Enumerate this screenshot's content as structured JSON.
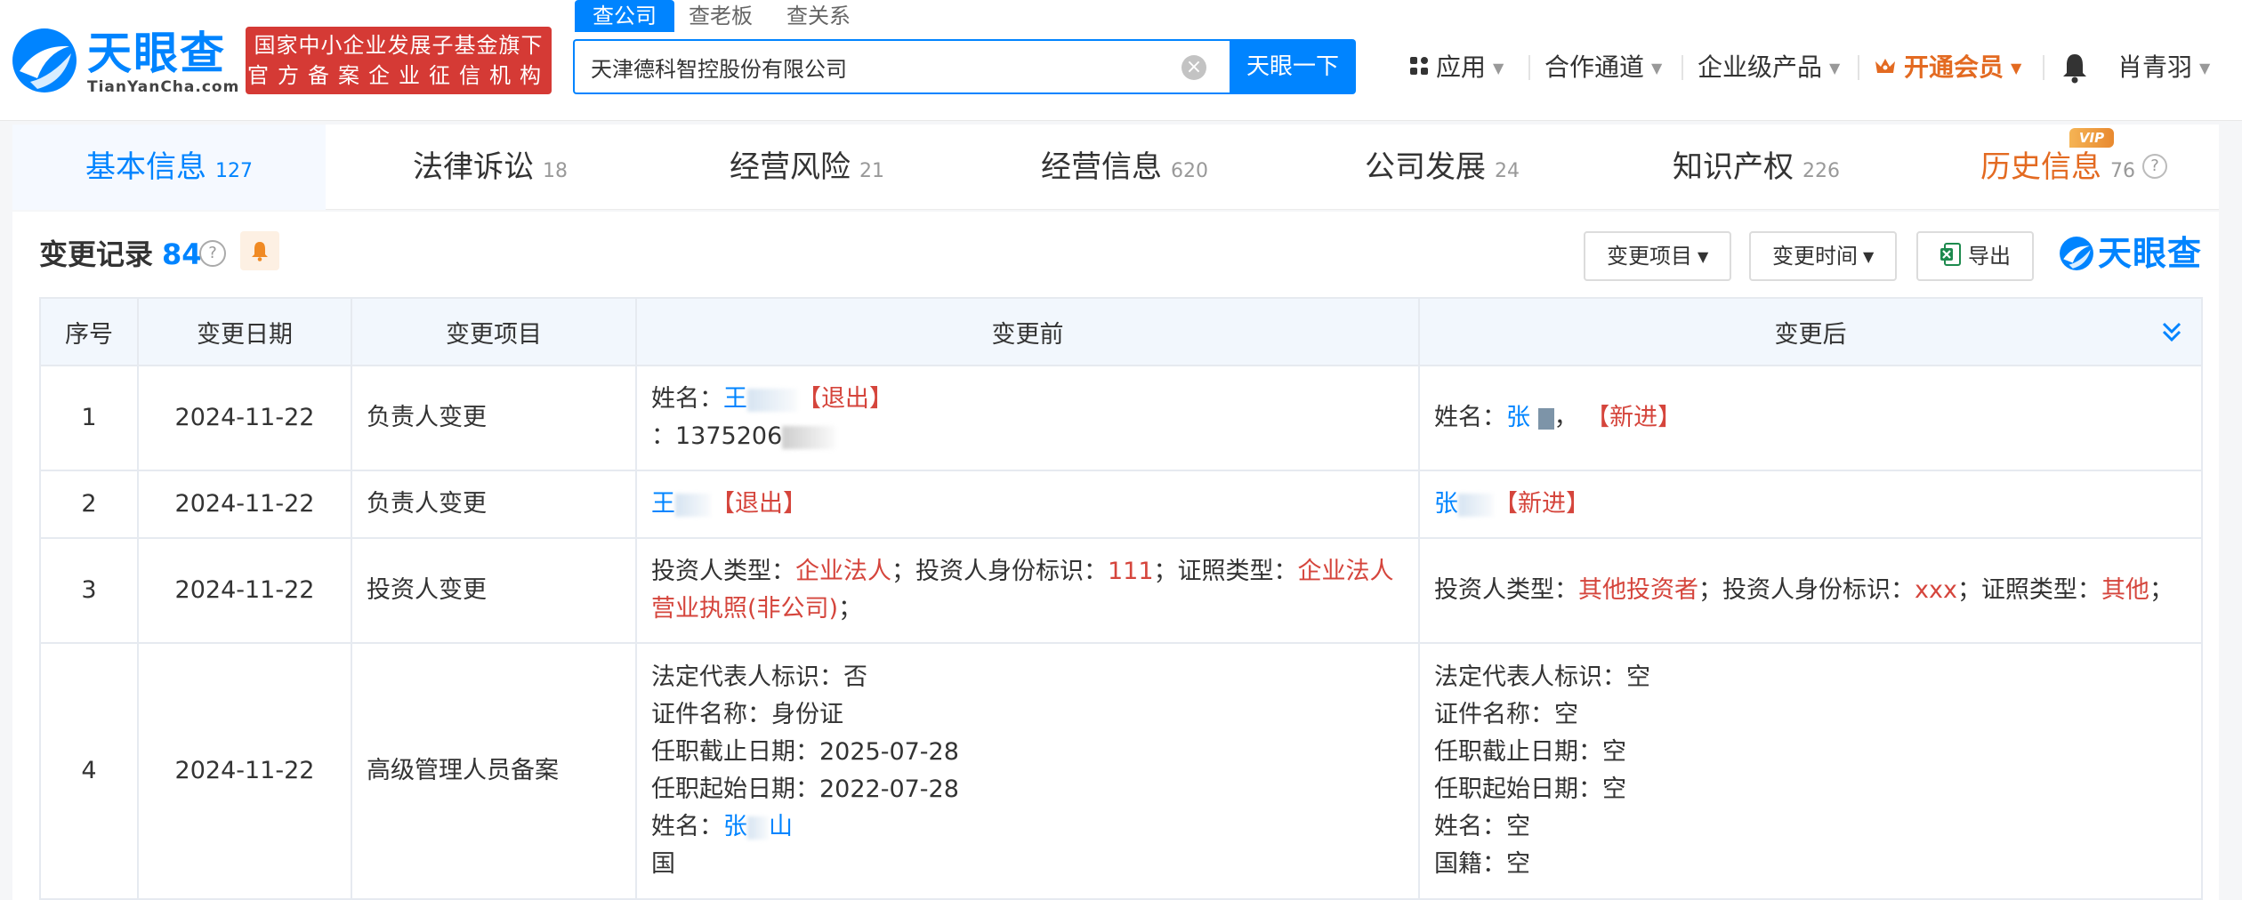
{
  "brand": {
    "name": "天眼查",
    "url": "TianYanCha.com",
    "badge_line1": "国家中小企业发展子基金旗下",
    "badge_line2": "官方备案企业征信机构",
    "accent": "#0084ff",
    "badge_color": "#d53a35"
  },
  "search": {
    "tabs": [
      {
        "label": "查公司",
        "active": true
      },
      {
        "label": "查老板",
        "active": false
      },
      {
        "label": "查关系",
        "active": false
      }
    ],
    "value": "天津德科智控股份有限公司",
    "button": "天眼一下"
  },
  "topnav": {
    "apps": "应用",
    "partner": "合作通道",
    "enterprise": "企业级产品",
    "vip": "开通会员",
    "user": "肖青羽",
    "vip_color": "#e36a21"
  },
  "modules": [
    {
      "label": "基本信息",
      "count": "127",
      "active": true
    },
    {
      "label": "法律诉讼",
      "count": "18"
    },
    {
      "label": "经营风险",
      "count": "21"
    },
    {
      "label": "经营信息",
      "count": "620"
    },
    {
      "label": "公司发展",
      "count": "24"
    },
    {
      "label": "知识产权",
      "count": "226"
    },
    {
      "label": "历史信息",
      "count": "76",
      "vip_tag": "VIP"
    }
  ],
  "section": {
    "title": "变更记录",
    "count": "84",
    "help": "?",
    "filter_item": "变更项目",
    "filter_time": "变更时间",
    "export": "导出",
    "watermark": "天眼查"
  },
  "table": {
    "headers": {
      "idx": "序号",
      "date": "变更日期",
      "item": "变更项目",
      "before": "变更前",
      "after": "变更后"
    },
    "rows": [
      {
        "idx": "1",
        "date": "2024-11-22",
        "item": "负责人变更",
        "b_name_label": "姓名：",
        "b_name": "王",
        "b_tag": "【退出】",
        "b_phone_prefix": "：",
        "b_phone": "1375206",
        "a_name_label": "姓名：",
        "a_name": "张",
        "a_sep": "，",
        "a_tag": "【新进】"
      },
      {
        "idx": "2",
        "date": "2024-11-22",
        "item": "负责人变更",
        "b_name": "王",
        "b_tag": "【退出】",
        "a_name": "张",
        "a_tag": "【新进】"
      },
      {
        "idx": "3",
        "date": "2024-11-22",
        "item": "投资人变更",
        "b_l1": "投资人类型：",
        "b_v1": "企业法人",
        "b_l2": "；投资人身份标识：",
        "b_v2": "111",
        "b_l3": "；证照类型：",
        "b_v3": "企业法人营业执照(非公司)",
        "b_end": "；",
        "a_l1": "投资人类型：",
        "a_v1": "其他投资者",
        "a_l2": "；投资人身份标识：",
        "a_v2": "xxx",
        "a_l3": "；证照类型：",
        "a_v3": "其他",
        "a_end": "；"
      },
      {
        "idx": "4",
        "date": "2024-11-22",
        "item": "高级管理人员备案",
        "b_lines": [
          "法定代表人标识：否",
          "证件名称：身份证",
          "任职截止日期：2025-07-28",
          "任职起始日期：2022-07-28"
        ],
        "b_name_label": "姓名：",
        "b_name_1": "张",
        "b_name_2": "山",
        "b_last": "国",
        "a_lines": [
          "法定代表人标识：空",
          "证件名称：空",
          "任职截止日期：空",
          "任职起始日期：空",
          "姓名：空",
          "国籍：空"
        ]
      }
    ]
  }
}
